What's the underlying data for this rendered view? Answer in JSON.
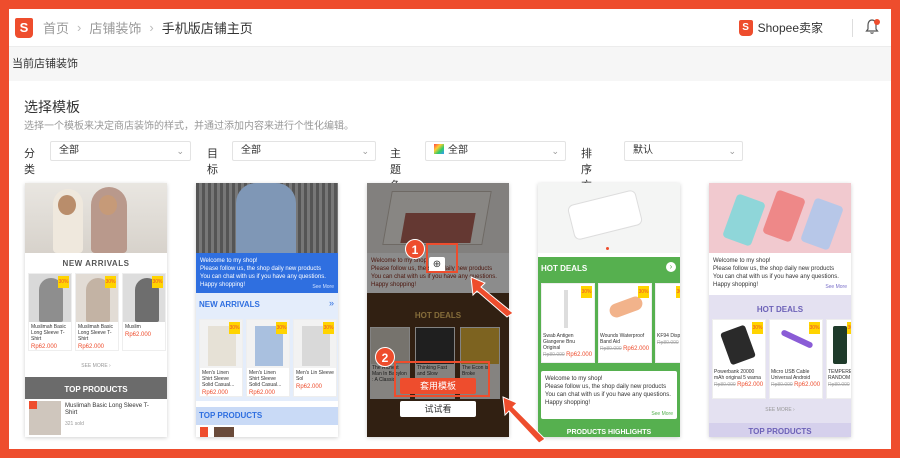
{
  "breadcrumb": {
    "home": "首页",
    "decoration": "店铺装饰",
    "current": "手机版店铺主页"
  },
  "header": {
    "seller_center": "Shopee卖家"
  },
  "current_store_label": "当前店铺装饰",
  "section": {
    "title": "选择模板",
    "subtitle": "选择一个模板来决定商店装饰的样式，并通过添加内容来进行个性化编辑。"
  },
  "filters": {
    "category": {
      "label": "分类",
      "value": "全部"
    },
    "target": {
      "label": "目标",
      "value": "全部"
    },
    "theme_color": {
      "label": "主题色",
      "value": "全部"
    },
    "sort": {
      "label": "排序方式",
      "value": "默认"
    }
  },
  "welcome_text": "Welcome to my shop!\nPlease follow us, the shop daily new products\nYou can chat with us if you have any questions. Happy shopping!",
  "see_more": "See More",
  "see_more_upper": "SEE MORE",
  "templates": [
    {
      "new_arrivals": "NEW ARRIVALS",
      "products": [
        {
          "name": "Muslimah Basic Long Sleeve T-Shirt",
          "price": "Rp62.000"
        },
        {
          "name": "Muslimah Basic Long Sleeve T-Shirt",
          "price": "Rp62.000"
        },
        {
          "name": "Muslim",
          "price": "Rp62.000"
        }
      ],
      "top_products": "TOP PRODUCTS",
      "top_product_name": "Muslimah Basic Long Sleeve T-Shirt",
      "top_product_sold": "321 sold"
    },
    {
      "new_arrivals": "NEW ARRIVALS",
      "products": [
        {
          "name": "Men's Linen Shirt Sleeve Solid Casual...",
          "price": "Rp62.000"
        },
        {
          "name": "Men's Linen Shirt Sleeve Solid Casual...",
          "price": "Rp62.000"
        },
        {
          "name": "Men's Lin Sleeve Sol",
          "price": "Rp62.000"
        }
      ],
      "top_products": "TOP PRODUCTS"
    },
    {
      "hot_deals": "HOT DEALS",
      "book1": "The Richest Man In Babylon : A Classic",
      "book2": "Thinking Fast and Slow",
      "book3": "The Econ is Broke",
      "apply_button": "套用模板",
      "try_button": "试试看"
    },
    {
      "hot_deals": "HOT DEALS",
      "products": [
        {
          "name": "Swab Antigen Giangene Bnu Original",
          "old_price": "Rp80.000",
          "price": "Rp62.000"
        },
        {
          "name": "Wounds Waterproof Band Aid",
          "old_price": "Rp80.000",
          "price": "Rp62.000"
        },
        {
          "name": "KF94 Disp 4 Ply Mask",
          "old_price": "Rp80.000",
          "price": "Rp62.000"
        }
      ],
      "welcome_short": "Welcome to my shop!\nPlease follow us, the shop daily new products\nYou can chat with us if you have any questions.\nHappy shopping!",
      "products_highlights": "PRODUCTS HIGHLIGHTS"
    },
    {
      "hot_deals": "HOT DEALS",
      "products": [
        {
          "name": "Powerbank 20000 mAh original 5 warna",
          "old_price": "Rp80.000",
          "price": "Rp62.000"
        },
        {
          "name": "Micro USB Cable Universal Android",
          "old_price": "Rp80.000",
          "price": "Rp62.000"
        },
        {
          "name": "TEMPERED RANDOM",
          "old_price": "Rp80.000",
          "price": ""
        }
      ],
      "top_products": "TOP PRODUCTS"
    }
  ],
  "badge": "30%",
  "annotations": {
    "step1": "1",
    "step2": "2"
  },
  "colors": {
    "brand": "#ee4d2d",
    "blue": "#2f6fe0",
    "green": "#56b04f"
  }
}
